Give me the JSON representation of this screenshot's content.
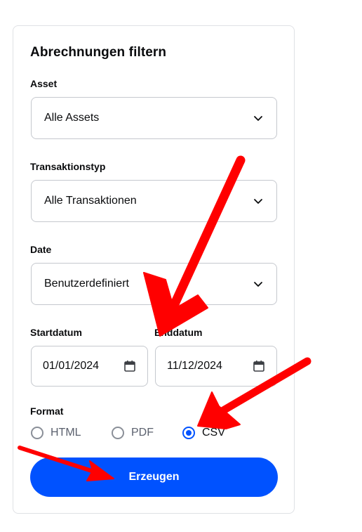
{
  "panel": {
    "title": "Abrechnungen filtern"
  },
  "asset": {
    "label": "Asset",
    "value": "Alle Assets"
  },
  "transaction_type": {
    "label": "Transaktionstyp",
    "value": "Alle Transaktionen"
  },
  "date": {
    "label": "Date",
    "value": "Benutzerdefiniert"
  },
  "start_date": {
    "label": "Startdatum",
    "value": "01/01/2024"
  },
  "end_date": {
    "label": "Enddatum",
    "value": "11/12/2024"
  },
  "format": {
    "label": "Format",
    "options": [
      "HTML",
      "PDF",
      "CSV"
    ],
    "selected": "CSV"
  },
  "generate_button": {
    "label": "Erzeugen"
  },
  "colors": {
    "accent": "#0052ff",
    "annotation_arrow": "#ff0000"
  }
}
